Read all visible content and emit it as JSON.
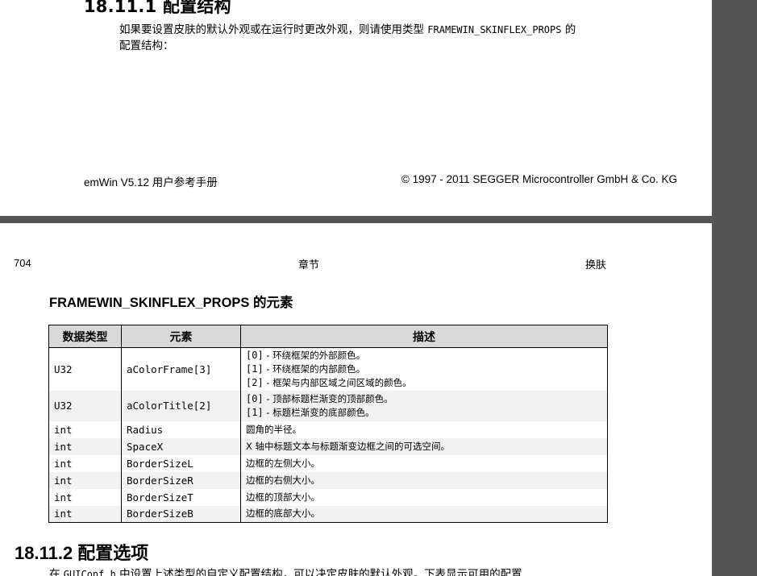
{
  "top_page": {
    "heading": "18.11.1 配置结构",
    "para_line1_before": "如果要设置皮肤的默认外观或在运行时更改外观，则请使用类型 ",
    "para_line1_code": "FRAMEWIN_SKINFLEX_PROPS",
    "para_line1_after": " 的",
    "para_line2": "配置结构：",
    "footer_left": "emWin V5.12 用户参考手册",
    "footer_right": "© 1997 - 2011 SEGGER Microcontroller GmbH & Co. KG"
  },
  "bottom_page": {
    "page_number": "704",
    "chapter_label": "章节",
    "section_label": "换肤",
    "table_title": "FRAMEWIN_SKINFLEX_PROPS 的元素",
    "table": {
      "headers": [
        "数据类型",
        "元素",
        "描述"
      ],
      "rows": [
        {
          "type": "U32",
          "element": "aColorFrame[3]",
          "desc": [
            {
              "idx": "[0]",
              "text": " - 环绕框架的外部颜色。"
            },
            {
              "idx": "[1]",
              "text": " - 环绕框架的内部颜色。"
            },
            {
              "idx": "[2]",
              "text": " - 框架与内部区域之间区域的颜色。"
            }
          ]
        },
        {
          "type": "U32",
          "element": "aColorTitle[2]",
          "desc": [
            {
              "idx": "[0]",
              "text": " - 顶部标题栏渐变的顶部颜色。"
            },
            {
              "idx": "[1]",
              "text": " - 标题栏渐变的底部颜色。"
            }
          ]
        },
        {
          "type": "int",
          "element": "Radius",
          "desc": [
            {
              "idx": "",
              "text": "圆角的半径。"
            }
          ]
        },
        {
          "type": "int",
          "element": "SpaceX",
          "desc": [
            {
              "idx": "",
              "text": "X 轴中标题文本与标题渐变边框之间的可选空间。"
            }
          ]
        },
        {
          "type": "int",
          "element": "BorderSizeL",
          "desc": [
            {
              "idx": "",
              "text": "边框的左侧大小。"
            }
          ]
        },
        {
          "type": "int",
          "element": "BorderSizeR",
          "desc": [
            {
              "idx": "",
              "text": "边框的右侧大小。"
            }
          ]
        },
        {
          "type": "int",
          "element": "BorderSizeT",
          "desc": [
            {
              "idx": "",
              "text": "边框的顶部大小。"
            }
          ]
        },
        {
          "type": "int",
          "element": "BorderSizeB",
          "desc": [
            {
              "idx": "",
              "text": "边框的底部大小。"
            }
          ]
        }
      ]
    },
    "section2_heading": "18.11.2 配置选项",
    "section2_para_before": "在 ",
    "section2_para_code": "GUIConf.h",
    "section2_para_after": " 中设置上述类型的自定义配置结构，可以决定皮肤的默认外观。下表显示可用的配置"
  },
  "colors": {
    "viewer_background": "#545454",
    "page": "#ffffff",
    "table_header": "#d9d9d9",
    "row_shade": "#f2f2f2"
  }
}
